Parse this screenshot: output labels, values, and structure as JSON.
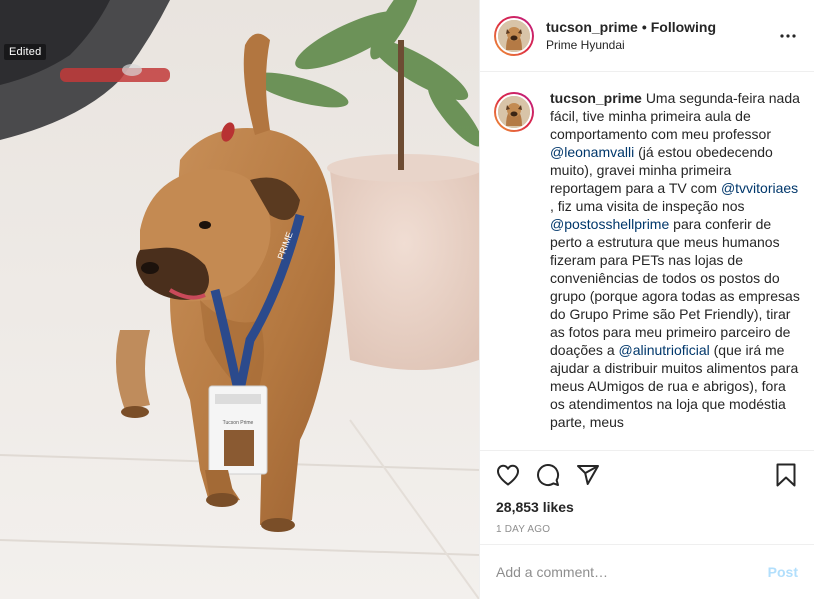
{
  "photo": {
    "alt_subject": "dog-with-lanyard-badge",
    "edited_badge": "Edited",
    "lanyard_text": "PRIME",
    "badge_name": "Tucson Prime"
  },
  "header": {
    "username": "tucson_prime",
    "separator": "•",
    "follow_status": "Following",
    "location": "Prime Hyundai",
    "more_icon": "more-horizontal-icon"
  },
  "caption": {
    "username": "tucson_prime",
    "segments": [
      {
        "type": "text",
        "value": "Uma segunda-feira nada fácil, tive minha primeira aula de comportamento com meu professor "
      },
      {
        "type": "mention",
        "value": "@leonamvalli"
      },
      {
        "type": "text",
        "value": " (já estou obedecendo muito), gravei minha primeira reportagem para a TV com "
      },
      {
        "type": "mention",
        "value": "@tvvitoriaes"
      },
      {
        "type": "text",
        "value": " , fiz uma visita de inspeção nos "
      },
      {
        "type": "mention",
        "value": "@postosshellprime"
      },
      {
        "type": "text",
        "value": " para conferir de perto a estrutura que meus humanos fizeram para PETs nas lojas de conveniências de todos os postos do grupo (porque agora todas as empresas do Grupo Prime são Pet Friendly), tirar as fotos para meu primeiro parceiro de doações a "
      },
      {
        "type": "mention",
        "value": "@alinutrioficial"
      },
      {
        "type": "text",
        "value": " (que irá me ajudar a distribuir muitos alimentos para meus AUmigos de rua e abrigos), fora os atendimentos na loja que modéstia parte, meus"
      }
    ]
  },
  "actions": {
    "like_icon": "heart-icon",
    "comment_icon": "comment-icon",
    "share_icon": "share-icon",
    "save_icon": "bookmark-icon"
  },
  "likes_text": "28,853 likes",
  "timestamp": "1 DAY AGO",
  "comment_box": {
    "placeholder": "Add a comment…",
    "post_label": "Post"
  },
  "colors": {
    "mention": "#00376b",
    "post_disabled": "#b2dffc",
    "muted": "#8e8e8e",
    "border": "#efefef"
  }
}
